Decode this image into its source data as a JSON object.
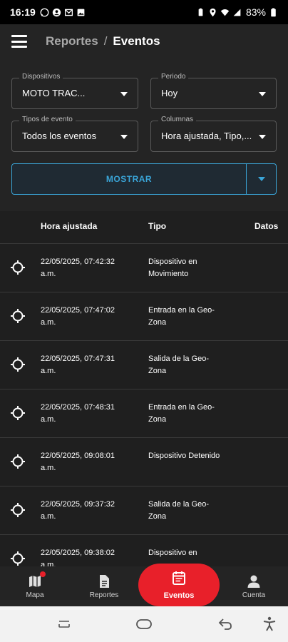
{
  "status_bar": {
    "time": "16:19",
    "battery": "83%",
    "left_icons": [
      "whatsapp-icon",
      "account-icon",
      "gmail-icon",
      "image-icon"
    ],
    "right_icons": [
      "battery-saver-icon",
      "location-icon",
      "wifi-icon",
      "signal-icon",
      "battery-icon"
    ]
  },
  "header": {
    "crumb_parent": "Reportes",
    "separator": "/",
    "crumb_current": "Eventos"
  },
  "filters": {
    "dispositivos": {
      "label": "Dispositivos",
      "value": "MOTO TRAC..."
    },
    "periodo": {
      "label": "Periodo",
      "value": "Hoy"
    },
    "tipos_evento": {
      "label": "Tipos de evento",
      "value": "Todos los eventos"
    },
    "columnas": {
      "label": "Columnas",
      "value": "Hora ajustada, Tipo,..."
    },
    "show_button": "MOSTRAR"
  },
  "table": {
    "headers": {
      "hora": "Hora ajustada",
      "tipo": "Tipo",
      "datos": "Datos"
    },
    "rows": [
      {
        "time_line1": "22/05/2025, 07:42:32",
        "time_line2": "a.m.",
        "type": "Dispositivo en Movimiento"
      },
      {
        "time_line1": "22/05/2025, 07:47:02",
        "time_line2": "a.m.",
        "type": "Entrada en la Geo-Zona"
      },
      {
        "time_line1": "22/05/2025, 07:47:31",
        "time_line2": "a.m.",
        "type": "Salida de la Geo-Zona"
      },
      {
        "time_line1": "22/05/2025, 07:48:31",
        "time_line2": "a.m.",
        "type": "Entrada en la Geo-Zona"
      },
      {
        "time_line1": "22/05/2025, 09:08:01",
        "time_line2": "a.m.",
        "type": "Dispositivo Detenido"
      },
      {
        "time_line1": "22/05/2025, 09:37:32",
        "time_line2": "a.m.",
        "type": "Salida de la Geo-Zona"
      },
      {
        "time_line1": "22/05/2025, 09:38:02",
        "time_line2": "a.m.",
        "type": "Dispositivo en"
      }
    ]
  },
  "bottom_nav": {
    "mapa": "Mapa",
    "reportes": "Reportes",
    "eventos": "Eventos",
    "cuenta": "Cuenta"
  },
  "colors": {
    "accent_blue": "#3aa5d8",
    "active_red": "#e8202a",
    "background": "#1f1f1f"
  }
}
